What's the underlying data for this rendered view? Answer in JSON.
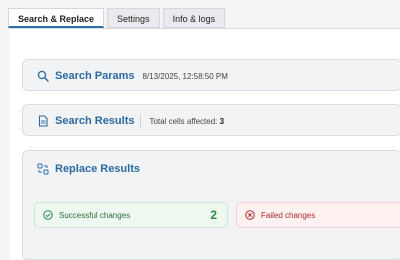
{
  "tabs": [
    {
      "label": "Search & Replace",
      "active": true
    },
    {
      "label": "Settings",
      "active": false
    },
    {
      "label": "Info & logs",
      "active": false
    }
  ],
  "search_params": {
    "title": "Search Params",
    "timestamp": "8/13/2025, 12:58:50 PM",
    "icon": "search-icon"
  },
  "search_results": {
    "title": "Search Results",
    "affected_label": "Total cells affected:",
    "affected_value": "3",
    "icon": "document-icon"
  },
  "replace_results": {
    "title": "Replace Results",
    "icon": "replace-icon",
    "successful": {
      "label": "Successful changes",
      "count": "2"
    },
    "failed": {
      "label": "Failed changes"
    }
  },
  "colors": {
    "accent": "#2b6aa0",
    "success": "#2c8a44",
    "error": "#b02a2a"
  }
}
